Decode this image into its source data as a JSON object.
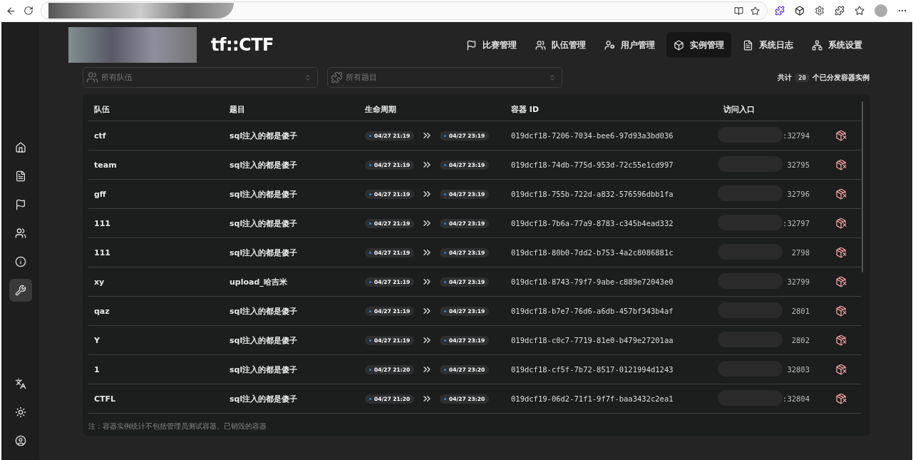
{
  "nav": [
    {
      "label": "比赛管理",
      "selected": false
    },
    {
      "label": "队伍管理",
      "selected": false
    },
    {
      "label": "用户管理",
      "selected": false
    },
    {
      "label": "实例管理",
      "selected": true
    },
    {
      "label": "系统日志",
      "selected": false
    },
    {
      "label": "系统设置",
      "selected": false
    }
  ],
  "logo": "tf::CTF",
  "sidebar": {
    "top": [
      {
        "selected": false
      },
      {
        "selected": false
      },
      {
        "selected": false
      },
      {
        "selected": false
      },
      {
        "selected": false
      },
      {
        "selected": true
      }
    ],
    "bottom": [
      {
        "selected": false
      },
      {
        "selected": false
      },
      {
        "selected": false
      }
    ]
  },
  "filters": [
    {
      "placeholder": "所有队伍"
    },
    {
      "placeholder": "所有题目"
    }
  ],
  "count": {
    "prefix": "共计",
    "value": "20",
    "suffix": "个已分发容器实例"
  },
  "table": {
    "columns": [
      "队伍",
      "题目",
      "生命周期",
      "容器 ID",
      "访问入口"
    ],
    "rows": [
      {
        "team": "ctf",
        "challenge": "sql注入的都是傻子",
        "start": "04/27 21:19",
        "end": "04/27 23:19",
        "container_id": "019dcf18-7206-7034-bee6-97d93a3bd036",
        "entry": ":32794"
      },
      {
        "team": "team",
        "challenge": "sql注入的都是傻子",
        "start": "04/27 21:19",
        "end": "04/27 23:19",
        "container_id": "019dcf18-74db-775d-953d-72c55e1cd997",
        "entry": "32795"
      },
      {
        "team": "gff",
        "challenge": "sql注入的都是傻子",
        "start": "04/27 21:19",
        "end": "04/27 23:19",
        "container_id": "019dcf18-755b-722d-a832-576596dbb1fa",
        "entry": "32796"
      },
      {
        "team": "111",
        "challenge": "sql注入的都是傻子",
        "start": "04/27 21:19",
        "end": "04/27 23:19",
        "container_id": "019dcf18-7b6a-77a9-8783-c345b4ead332",
        "entry": ":32797"
      },
      {
        "team": "111",
        "challenge": "sql注入的都是傻子",
        "start": "04/27 21:19",
        "end": "04/27 23:19",
        "container_id": "019dcf18-80b0-7dd2-b753-4a2c8086881c",
        "entry": "2798"
      },
      {
        "team": "xy",
        "challenge": "upload_哈吉米",
        "start": "04/27 21:19",
        "end": "04/27 23:19",
        "container_id": "019dcf18-8743-79f7-9abe-c889e72043e0",
        "entry": "32799"
      },
      {
        "team": "qaz",
        "challenge": "sql注入的都是傻子",
        "start": "04/27 21:19",
        "end": "04/27 23:19",
        "container_id": "019dcf18-b7e7-76d6-a6db-457bf343b4af",
        "entry": "2801"
      },
      {
        "team": "Y",
        "challenge": "sql注入的都是傻子",
        "start": "04/27 21:19",
        "end": "04/27 23:19",
        "container_id": "019dcf18-c0c7-7719-81e0-b479e27201aa",
        "entry": "2802"
      },
      {
        "team": "1",
        "challenge": "sql注入的都是傻子",
        "start": "04/27 21:20",
        "end": "04/27 23:20",
        "container_id": "019dcf18-cf5f-7b72-8517-0121994d1243",
        "entry": "32803"
      },
      {
        "team": "CTFL",
        "challenge": "sql注入的都是傻子",
        "start": "04/27 21:20",
        "end": "04/27 23:20",
        "container_id": "019dcf19-06d2-71f1-9f7f-baa3432c2ea1",
        "entry": ":32804"
      }
    ]
  },
  "note": "注：容器实例统计不包括管理员测试容器、已销毁的容器"
}
